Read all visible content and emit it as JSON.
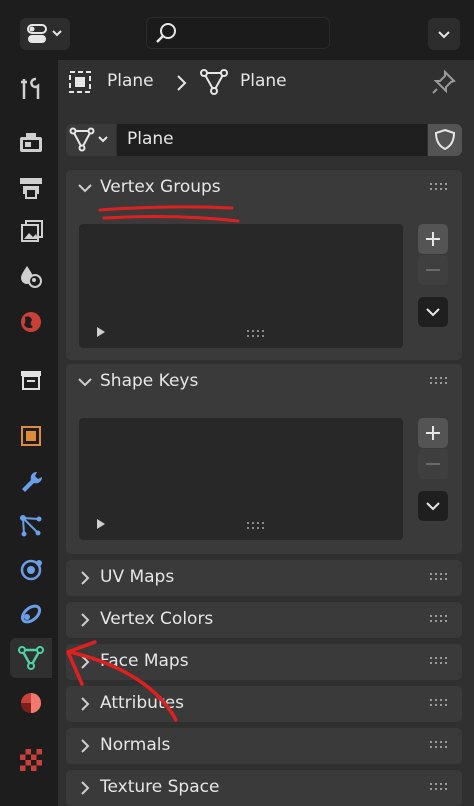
{
  "header": {
    "search_placeholder": ""
  },
  "breadcrumb": {
    "object": "Plane",
    "mesh": "Plane"
  },
  "datablock": {
    "name": "Plane"
  },
  "panels": [
    {
      "label": "Vertex Groups",
      "expanded": true
    },
    {
      "label": "Shape Keys",
      "expanded": true
    },
    {
      "label": "UV Maps",
      "expanded": false
    },
    {
      "label": "Vertex Colors",
      "expanded": false
    },
    {
      "label": "Face Maps",
      "expanded": false
    },
    {
      "label": "Attributes",
      "expanded": false
    },
    {
      "label": "Normals",
      "expanded": false
    },
    {
      "label": "Texture Space",
      "expanded": false
    }
  ],
  "sidebar_tabs": [
    "tool-icon",
    "render-icon",
    "output-icon",
    "view-layer-icon",
    "scene-icon",
    "world-icon",
    "collection-icon",
    "object-icon",
    "modifier-icon",
    "particles-icon",
    "physics-icon",
    "constraints-icon",
    "data-icon",
    "material-icon",
    "texture-icon"
  ],
  "colors": {
    "annotation": "#e02020",
    "active_data": "#4fd1a5"
  }
}
